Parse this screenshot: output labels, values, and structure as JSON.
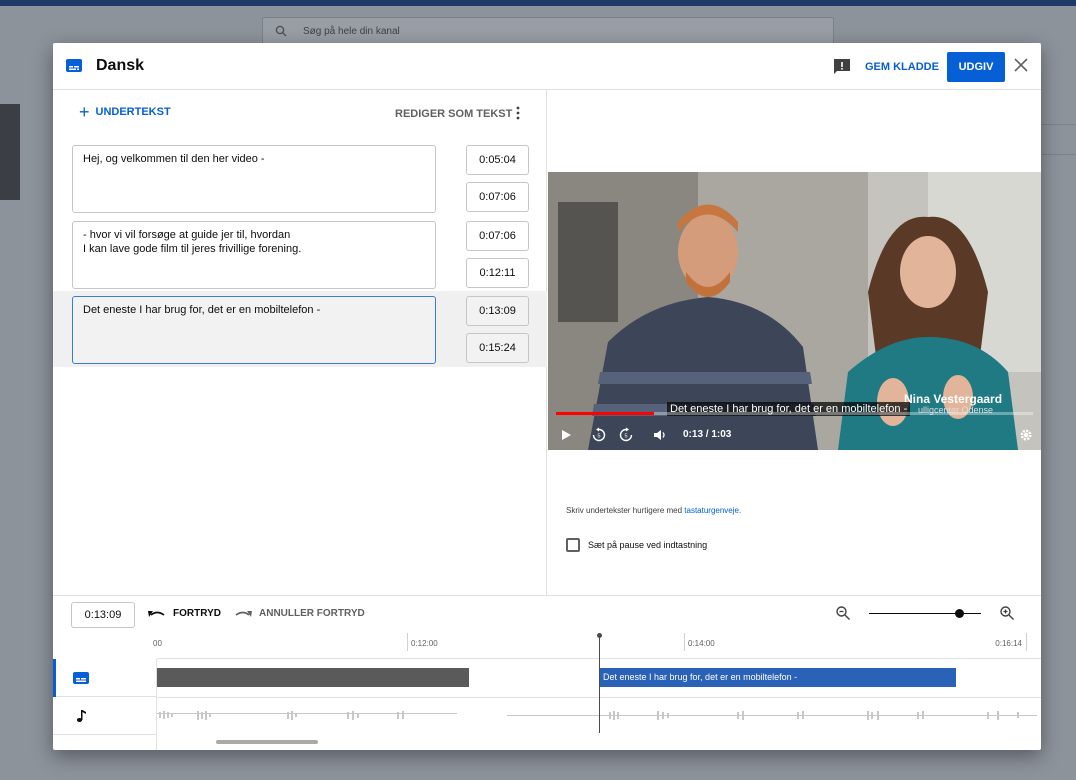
{
  "background": {
    "search_placeholder": "Søg på hele din kanal"
  },
  "dialog": {
    "title": "Dansk",
    "draft_label": "GEM KLADDE",
    "publish_label": "UDGIV"
  },
  "editor": {
    "add_label": "UNDERTEKST",
    "edit_as_text_label": "REDIGER SOM TEKST",
    "cues": [
      {
        "lines": [
          "Hej, og velkommen til den her video -"
        ],
        "start": "0:05:04",
        "end": "0:07:06",
        "active": false
      },
      {
        "lines": [
          "- hvor vi vil forsøge at guide jer til, hvordan",
          "I kan lave gode film til jeres frivillige forening."
        ],
        "start": "0:07:06",
        "end": "0:12:11",
        "active": false
      },
      {
        "lines": [
          "Det eneste I har brug for, det er en mobiltelefon -"
        ],
        "start": "0:13:09",
        "end": "0:15:24",
        "active": true
      }
    ]
  },
  "video": {
    "caption": "Det eneste I har brug for, det er en mobiltelefon -",
    "name_overlay": "Nina Vestergaard",
    "sub_overlay": "ulligcenter Odense",
    "time_display": "0:13 / 1:03",
    "progress": 0.206
  },
  "hint": {
    "text": "Skriv undertekster hurtigere med ",
    "link": "tastaturgenveje",
    "suffix": "."
  },
  "pause_option": {
    "label": "Sæt på pause ved indtastning",
    "checked": false
  },
  "timeline": {
    "current_time": "0:13:09",
    "undo_label": "FORTRYD",
    "redo_label": "ANNULLER FORTRYD",
    "zoom_level": 0.8,
    "ruler_labels": [
      "00",
      "0:12:00",
      "0:14:00",
      "0:16:14"
    ],
    "current_segment_text": "Det eneste I har brug for, det er en mobiltelefon -"
  },
  "colors": {
    "accent": "#065fd4",
    "segment": "#2962b7",
    "progress": "#ff0000"
  }
}
